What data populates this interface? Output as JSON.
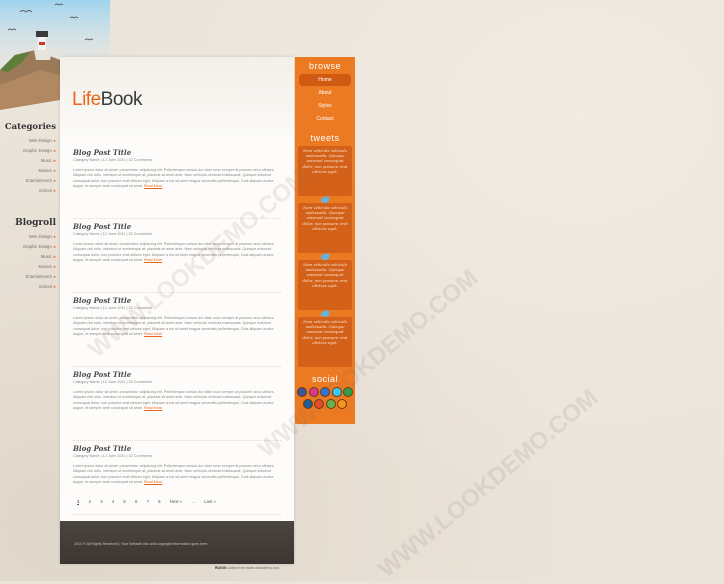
{
  "logo": {
    "part1": "Life",
    "part2": "Book"
  },
  "left_sidebar": {
    "categories_heading": "Categories",
    "categories": [
      "Web Design",
      "Graphic Design",
      "Music",
      "Movies",
      "Entertainment",
      "School"
    ],
    "blogroll_heading": "Blogroll",
    "blogroll": [
      "Web Design",
      "Graphic Design",
      "Music",
      "Movies",
      "Entertainment",
      "School"
    ]
  },
  "posts": [
    {
      "title": "Blog Post Title",
      "meta": "Category Name | 12 June 2011 | 32 Comments",
      "body": "Lorem ipsum dolor sit amet, consectetur adipiscing elit. Pellentesque cursus dui vitae nunc semper at posuere arcu ultrices. Aliquam nisl odio, interdum ut scelerisque at, placerat sit amet ante. Nam vehicula vehicula malesuada. Quisque euismod consequat dolor, non posuere erat ultrices eget. Aliquam a est sit amet magna venenatis pellentesque. Duis aliquam auctor augue, et semper ante consequat sit amet.",
      "more": "Read More"
    },
    {
      "title": "Blog Post Title",
      "meta": "Category Name | 12 June 2011 | 32 Comments",
      "body": "Lorem ipsum dolor sit amet, consectetur adipiscing elit. Pellentesque cursus dui vitae nunc semper at posuere arcu ultrices. Aliquam nisl odio, interdum ut scelerisque at, placerat sit amet ante. Nam vehicula vehicula malesuada. Quisque euismod consequat dolor, non posuere erat ultrices eget. Aliquam a est sit amet magna venenatis pellentesque. Duis aliquam auctor augue, et semper ante consequat sit amet.",
      "more": "Read More"
    },
    {
      "title": "Blog Post Title",
      "meta": "Category Name | 12 June 2011 | 32 Comments",
      "body": "Lorem ipsum dolor sit amet, consectetur adipiscing elit. Pellentesque cursus dui vitae nunc semper at posuere arcu ultrices. Aliquam nisl odio, interdum ut scelerisque at, placerat sit amet ante. Nam vehicula vehicula malesuada. Quisque euismod consequat dolor, non posuere erat ultrices eget. Aliquam a est sit amet magna venenatis pellentesque. Duis aliquam auctor augue, et semper ante consequat sit amet.",
      "more": "Read More"
    },
    {
      "title": "Blog Post Title",
      "meta": "Category Name | 12 June 2011 | 32 Comments",
      "body": "Lorem ipsum dolor sit amet, consectetur adipiscing elit. Pellentesque cursus dui vitae nunc semper at posuere arcu ultrices. Aliquam nisl odio, interdum ut scelerisque at, placerat sit amet ante. Nam vehicula vehicula malesuada. Quisque euismod consequat dolor, non posuere erat ultrices eget. Aliquam a est sit amet magna venenatis pellentesque. Duis aliquam auctor augue, et semper ante consequat sit amet.",
      "more": "Read More"
    },
    {
      "title": "Blog Post Title",
      "meta": "Category Name | 12 June 2011 | 32 Comments",
      "body": "Lorem ipsum dolor sit amet, consectetur adipiscing elit. Pellentesque cursus dui vitae nunc semper at posuere arcu ultrices. Aliquam nisl odio, interdum ut scelerisque at, placerat sit amet ante. Nam vehicula vehicula malesuada. Quisque euismod consequat dolor, non posuere erat ultrices eget. Aliquam a est sit amet magna venenatis pellentesque. Duis aliquam auctor augue, et semper ante consequat sit amet.",
      "more": "Read More"
    }
  ],
  "pager": {
    "pages": [
      "1",
      "2",
      "3",
      "4",
      "5",
      "6",
      "7",
      "8"
    ],
    "current": "1",
    "next": "Next »",
    "ellipsis": "...",
    "last": "Last »"
  },
  "footer": {
    "text": "2014 © All Rights Reserved | Your Website Info and copyright information goes here."
  },
  "orange": {
    "browse_heading": "browse",
    "nav": [
      "Home",
      "About",
      "Styles",
      "Contact"
    ],
    "current_nav": "Home",
    "tweets_heading": "tweets",
    "tweet_text": "Nam vehicula vehicula malesuada. Quisque euismod consequat dolor, non posuere erat ultrices eget.",
    "tweet_count": 4,
    "social_heading": "social",
    "social_icons_row1": [
      "facebook-icon",
      "flickr-icon",
      "delicious-icon",
      "twitter-icon",
      "skype-icon"
    ],
    "social_icons_row2": [
      "digg-icon",
      "stumbleupon-icon",
      "technorati-icon",
      "rss-icon"
    ]
  },
  "watermark": "WWW.LOOKDEMO.COM",
  "credit": {
    "brand": "RUGGI",
    "text": "collect from www.downdemo.com"
  },
  "colors": {
    "accent": "#ec7a22",
    "accent_dark": "#d4611a",
    "footer": "#3c3632",
    "background": "#ebe4da"
  }
}
